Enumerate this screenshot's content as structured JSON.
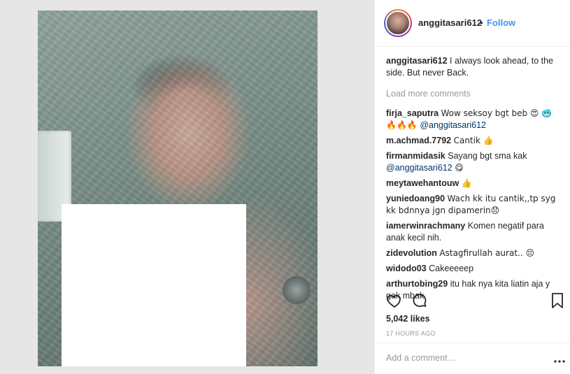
{
  "post": {
    "username": "anggitasari612",
    "separator": "•",
    "follow_label": "Follow",
    "caption": {
      "user": "anggitasari612",
      "text": "I always look ahead, to the side. But never Back."
    },
    "load_more_label": "Load more comments",
    "comments": [
      {
        "user": "firja_saputra",
        "text": "Wow seksoy bgt beb 😍 🥶",
        "line2_emoji": "🔥🔥🔥",
        "mention": "@anggitasari612"
      },
      {
        "user": "m.achmad.7792",
        "text": "Cantik 👍"
      },
      {
        "user": "firmanmidasik",
        "text": "Sayang bgt sma kak",
        "mention": "@anggitasari612",
        "trail": "😋"
      },
      {
        "user": "meytawehantouw",
        "text": "👍"
      },
      {
        "user": "yuniedoang90",
        "text": "Wach kk itu cantik,,tp syg kk bdnnya jgn dipamerin😞"
      },
      {
        "user": "iamerwinrachmany",
        "text": "Komen negatif para anak kecil nih."
      },
      {
        "user": "zidevolution",
        "text": "Astagfirullah aurat.. 😔"
      },
      {
        "user": "widodo03",
        "text": "Cakeeeeep"
      },
      {
        "user": "arthurtobing29",
        "text": "itu hak nya kita liatin aja y gak mbak"
      }
    ],
    "likes": "5,042 likes",
    "timestamp": "17 HOURS AGO",
    "add_comment_placeholder": "Add a comment…",
    "icons": {
      "like": "heart-icon",
      "comment": "comment-bubble-icon",
      "save": "bookmark-icon",
      "more": "more-dots-icon"
    },
    "colors": {
      "follow": "#3897f0",
      "mention": "#003569",
      "muted": "#999999",
      "text": "#262626"
    }
  }
}
